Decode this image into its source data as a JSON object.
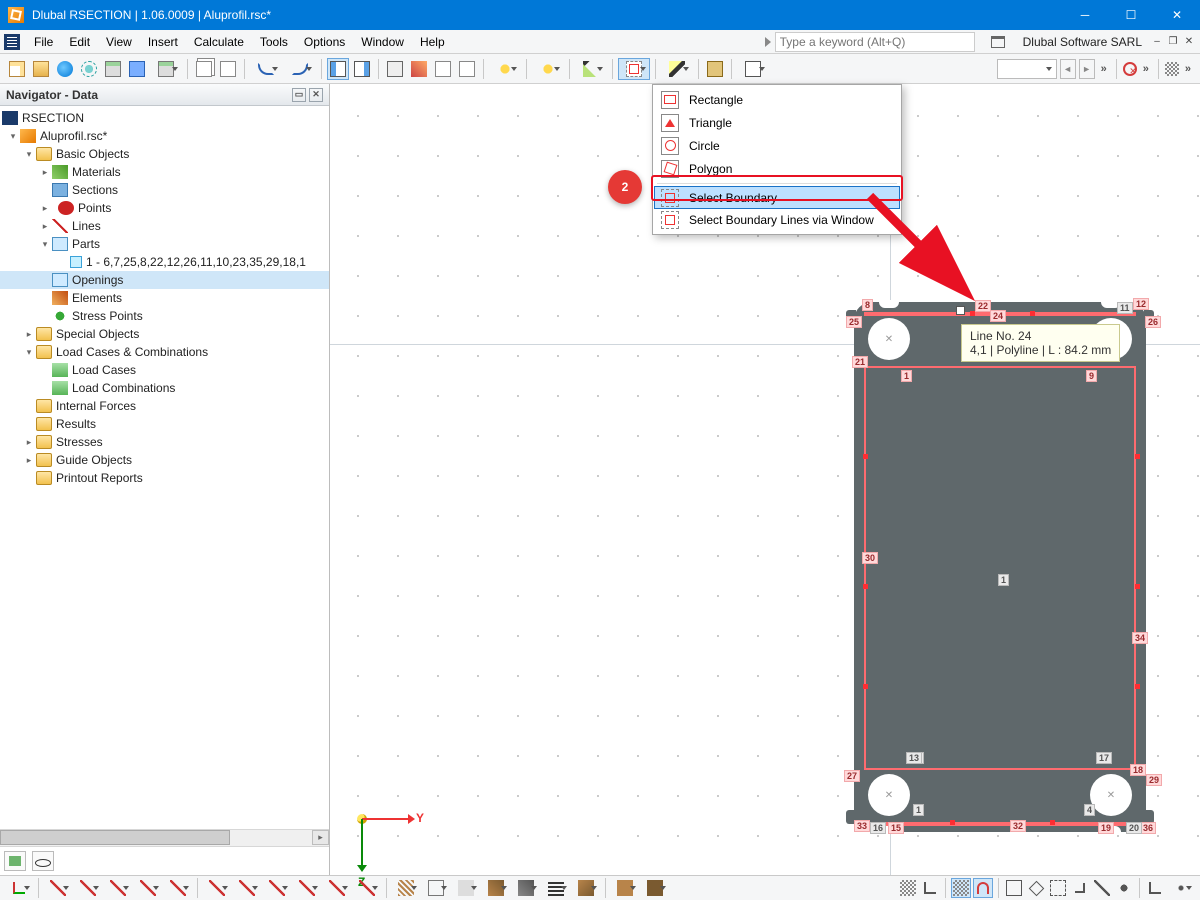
{
  "window": {
    "title": "Dlubal RSECTION | 1.06.0009 | Aluprofil.rsc*"
  },
  "menubar": {
    "items": [
      "File",
      "Edit",
      "View",
      "Insert",
      "Calculate",
      "Tools",
      "Options",
      "Window",
      "Help"
    ],
    "search_placeholder": "Type a keyword (Alt+Q)",
    "brand": "Dlubal Software SARL"
  },
  "navigator": {
    "title": "Navigator - Data",
    "root": "RSECTION",
    "project": "Aluprofil.rsc*",
    "basic_objects": "Basic Objects",
    "materials": "Materials",
    "sections": "Sections",
    "points": "Points",
    "lines": "Lines",
    "parts": "Parts",
    "parts_list": "1 - 6,7,25,8,22,12,26,11,10,23,35,29,18,1",
    "openings": "Openings",
    "elements": "Elements",
    "stress_points": "Stress Points",
    "special_objects": "Special Objects",
    "lc_comb": "Load Cases & Combinations",
    "load_cases": "Load Cases",
    "load_combinations": "Load Combinations",
    "internal_forces": "Internal Forces",
    "results": "Results",
    "stresses": "Stresses",
    "guide_objects": "Guide Objects",
    "printout": "Printout Reports"
  },
  "dropdown": {
    "rectangle": "Rectangle",
    "triangle": "Triangle",
    "circle": "Circle",
    "polygon": "Polygon",
    "select_boundary": "Select Boundary",
    "select_boundary_win": "Select Boundary Lines via Window"
  },
  "callout": {
    "badge": "2"
  },
  "canvas": {
    "tooltip_line1": "Line No. 24",
    "tooltip_line2": "4,1 | Polyline | L : 84.2 mm",
    "axis_y": "Y",
    "axis_z": "Z",
    "labels": {
      "n1": "1",
      "n4": "4",
      "n8": "8",
      "n9": "9",
      "n11": "11",
      "n12": "12",
      "n13": "13",
      "n15": "15",
      "n16": "16",
      "n17": "17",
      "n18": "18",
      "n19": "19",
      "n20": "20",
      "n21": "21",
      "n22": "22",
      "n24": "24",
      "n25": "25",
      "n26": "26",
      "n27": "27",
      "n29": "29",
      "n30": "30",
      "n32": "32",
      "n33": "33",
      "n34": "34",
      "n36": "36"
    }
  }
}
